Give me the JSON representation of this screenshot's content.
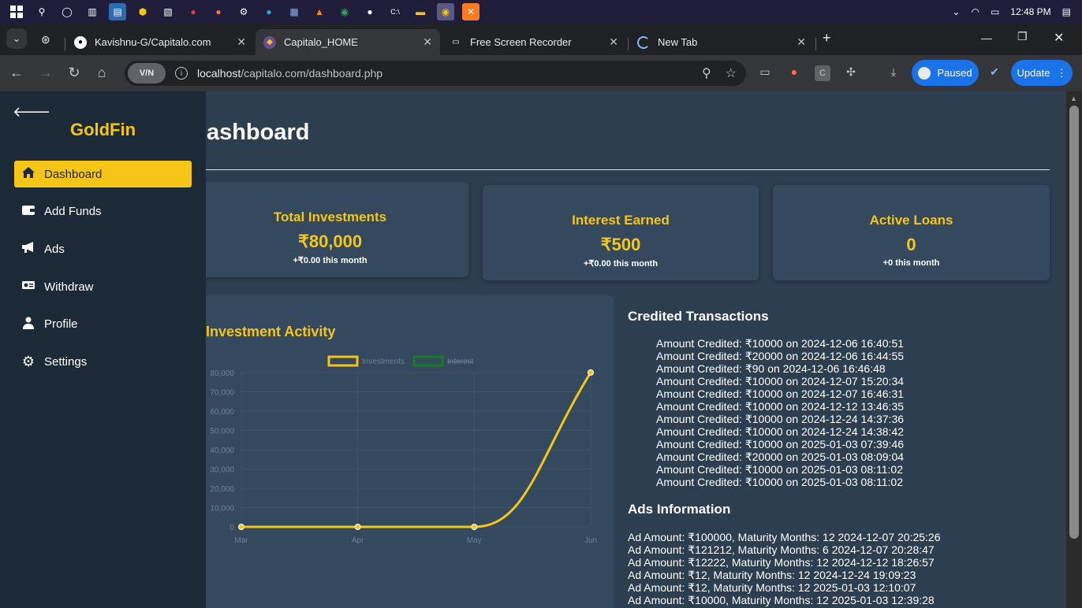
{
  "taskbar": {
    "time": "12:48 PM"
  },
  "browser": {
    "tabs": [
      {
        "title": "Kavishnu-G/Capitalo.com",
        "icon": "github-icon"
      },
      {
        "title": "Capitalo_HOME",
        "icon": "site-icon",
        "active": true
      },
      {
        "title": "Free Screen Recorder",
        "icon": "screen-icon"
      },
      {
        "title": "New Tab",
        "icon": "loading-icon"
      }
    ],
    "url_host": "localhost",
    "url_path": "/capitalo.com/dashboard.php",
    "vpn_label": "V/N",
    "paused_label": "Paused",
    "update_label": "Update"
  },
  "sidebar": {
    "brand": "GoldFin",
    "items": [
      {
        "label": "Dashboard",
        "icon": "home-icon",
        "active": true
      },
      {
        "label": "Add Funds",
        "icon": "wallet-icon"
      },
      {
        "label": "Ads",
        "icon": "megaphone-icon"
      },
      {
        "label": "Withdraw",
        "icon": "money-icon"
      },
      {
        "label": "Profile",
        "icon": "user-icon"
      },
      {
        "label": "Settings",
        "icon": "gear-icon"
      }
    ]
  },
  "main": {
    "title": "Dashboard",
    "cards": [
      {
        "title": "Total Investments",
        "value": "₹80,000",
        "sub": "+₹0.00 this month"
      },
      {
        "title": "Interest Earned",
        "value": "₹500",
        "sub": "+₹0.00 this month"
      },
      {
        "title": "Active Loans",
        "value": "0",
        "sub": "+0 this month"
      }
    ],
    "chart_heading": "Investment Activity",
    "credited_heading": "Credited Transactions",
    "credited": [
      "Amount Credited: ₹10000 on 2024-12-06 16:40:51",
      "Amount Credited: ₹20000 on 2024-12-06 16:44:55",
      "Amount Credited: ₹90 on 2024-12-06 16:46:48",
      "Amount Credited: ₹10000 on 2024-12-07 15:20:34",
      "Amount Credited: ₹10000 on 2024-12-07 16:46:31",
      "Amount Credited: ₹10000 on 2024-12-12 13:46:35",
      "Amount Credited: ₹10000 on 2024-12-24 14:37:36",
      "Amount Credited: ₹10000 on 2024-12-24 14:38:42",
      "Amount Credited: ₹10000 on 2025-01-03 07:39:46",
      "Amount Credited: ₹20000 on 2025-01-03 08:09:04",
      "Amount Credited: ₹10000 on 2025-01-03 08:11:02",
      "Amount Credited: ₹10000 on 2025-01-03 08:11:02"
    ],
    "ads_heading": "Ads Information",
    "ads": [
      "Ad Amount: ₹100000, Maturity Months: 12 2024-12-07 20:25:26",
      "Ad Amount: ₹121212, Maturity Months: 6 2024-12-07 20:28:47",
      "Ad Amount: ₹12222, Maturity Months: 12 2024-12-12 18:26:57",
      "Ad Amount: ₹12, Maturity Months: 12 2024-12-24 19:09:23",
      "Ad Amount: ₹12, Maturity Months: 12 2025-01-03 12:10:07",
      "Ad Amount: ₹10000, Maturity Months: 12 2025-01-03 12:39:28"
    ]
  },
  "chart_data": {
    "type": "line",
    "x": [
      "Mar",
      "Apr",
      "May",
      "Jun"
    ],
    "series": [
      {
        "name": "Investments",
        "values": [
          0,
          0,
          0,
          80000
        ],
        "color": "#f5c518"
      },
      {
        "name": "Interest",
        "values": [],
        "color": "#1a7a2a"
      }
    ],
    "ylim": [
      0,
      80000
    ],
    "yticks": [
      "0",
      "10,000",
      "20,000",
      "30,000",
      "40,000",
      "50,000",
      "60,000",
      "70,000",
      "80,000"
    ],
    "grid": true,
    "legend_position": "top"
  }
}
